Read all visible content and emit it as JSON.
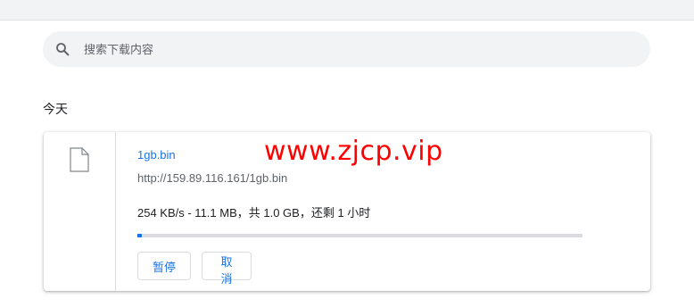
{
  "search": {
    "placeholder": "搜索下载内容",
    "icon": "search-icon"
  },
  "date_header": "今天",
  "download": {
    "file_name": "1gb.bin",
    "url": "http://159.89.116.161/1gb.bin",
    "status": "254 KB/s - 11.1 MB，共 1.0 GB，还剩 1 小时",
    "progress": 0.011,
    "file_icon": "file-icon",
    "pause_label": "暂停",
    "cancel_label": "取消"
  },
  "watermark": "www.zjcp.vip",
  "colors": {
    "accent": "#1a73e8",
    "watermark": "#ff0000",
    "search_background": "#f1f3f4"
  }
}
